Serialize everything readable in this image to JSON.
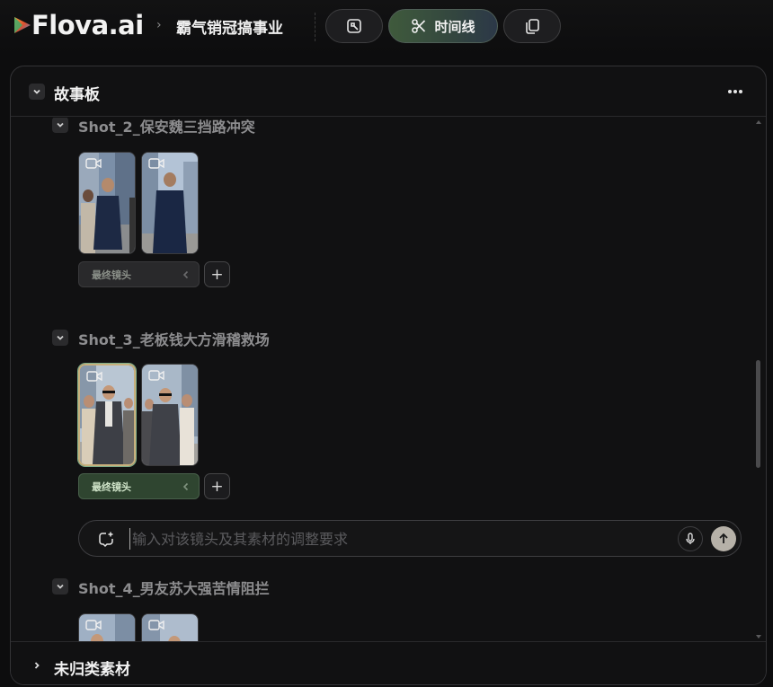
{
  "header": {
    "brand": "Flova.ai",
    "project_title": "霸气销冠搞事业",
    "buttons": [
      {
        "icon": "frame-icon"
      },
      {
        "icon": "scissors-icon",
        "label": "时间线"
      },
      {
        "icon": "copy-icon"
      }
    ]
  },
  "storyboard": {
    "title": "故事板",
    "shots": [
      {
        "title": "Shot_2_保安魏三挡路冲突",
        "final_label": "最终镜头",
        "active": false
      },
      {
        "title": "Shot_3_老板钱大方滑稽救场",
        "final_label": "最终镜头",
        "active": true
      },
      {
        "title": "Shot_4_男友苏大强苦情阻拦"
      }
    ],
    "prompt": {
      "placeholder": "输入对该镜头及其素材的调整要求"
    }
  },
  "footer": {
    "title": "未归类素材"
  },
  "colors": {
    "accent_green": "#2f4530",
    "send_button": "#b6b1a8",
    "timeline_button": "#3f5a3c"
  }
}
